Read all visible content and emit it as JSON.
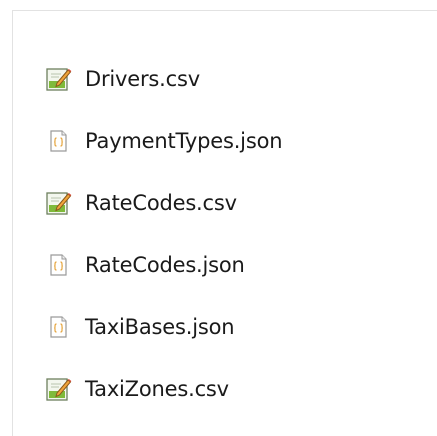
{
  "files": [
    {
      "name": "Drivers.csv",
      "icon": "csv-file-icon"
    },
    {
      "name": "PaymentTypes.json",
      "icon": "json-file-icon"
    },
    {
      "name": "RateCodes.csv",
      "icon": "csv-file-icon"
    },
    {
      "name": "RateCodes.json",
      "icon": "json-file-icon"
    },
    {
      "name": "TaxiBases.json",
      "icon": "json-file-icon"
    },
    {
      "name": "TaxiZones.csv",
      "icon": "csv-file-icon"
    }
  ]
}
